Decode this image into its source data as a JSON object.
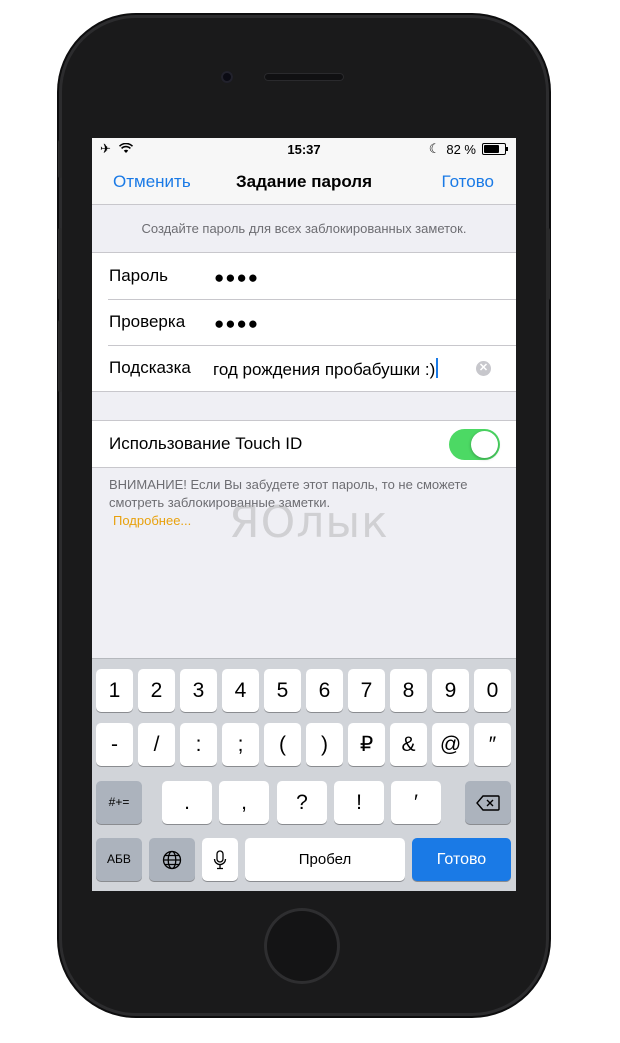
{
  "status_bar": {
    "airplane_icon": "✈",
    "wifi_icon": "wifi",
    "time": "15:37",
    "moon_icon": "☾",
    "battery_percent_text": "82 %",
    "battery_level": 0.82
  },
  "nav": {
    "cancel_label": "Отменить",
    "title": "Задание пароля",
    "done_label": "Готово"
  },
  "hint_text": "Создайте пароль для всех заблокированных заметок.",
  "form": {
    "password_label": "Пароль",
    "password_value": "●●●●",
    "verify_label": "Проверка",
    "verify_value": "●●●●",
    "hint_label": "Подсказка",
    "hint_value": "год рождения пробабушки :)"
  },
  "touch_id": {
    "label": "Использование Touch ID",
    "enabled": true
  },
  "warning": {
    "text": "ВНИМАНИЕ! Если Вы забудете этот пароль, то не сможете смотреть заблокированные заметки.",
    "more_link": "Подробнее..."
  },
  "watermark": "ЯОлык",
  "keyboard": {
    "row1": [
      "1",
      "2",
      "3",
      "4",
      "5",
      "6",
      "7",
      "8",
      "9",
      "0"
    ],
    "row2": [
      "-",
      "/",
      ":",
      ";",
      "(",
      ")",
      "₽",
      "&",
      "@",
      "″"
    ],
    "row3": [
      ".",
      ",",
      "?",
      "!",
      "′"
    ],
    "symbols_key": "#+=",
    "alpha_key": "АБВ",
    "space_key": "Пробел",
    "return_key": "Готово",
    "colors": {
      "accent": "#1a7ae6",
      "toggle_on": "#4cd964",
      "link": "#e8a10d"
    }
  }
}
